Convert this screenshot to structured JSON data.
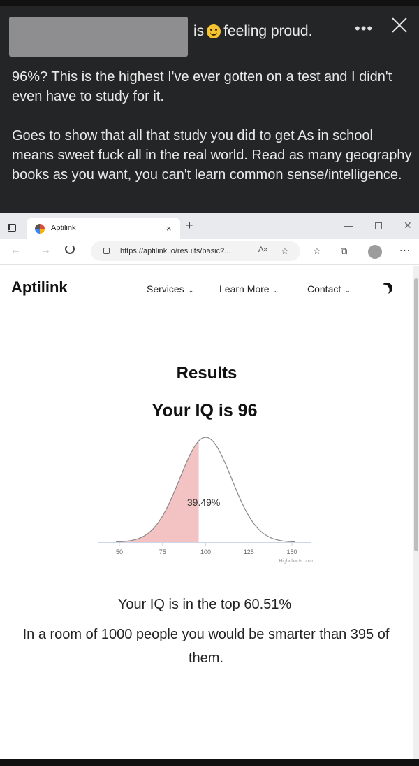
{
  "post": {
    "status_prefix": "is",
    "status_text": "feeling proud.",
    "paragraph1": "96%? This is the highest I've ever gotten on a test and I didn't even have to study for it.",
    "paragraph2": "Goes to show that all that study you did to get As in school means sweet fuck all in the real world. Read as many geography books as you want, you can't learn common sense/intelligence."
  },
  "browser": {
    "tab_title": "Aptilink",
    "tab_close": "×",
    "new_tab": "+",
    "url": "https://aptilink.io/results/basic?...",
    "read_aloud": "A»"
  },
  "site": {
    "logo": "Aptilink",
    "nav": [
      "Services",
      "Learn More",
      "Contact"
    ],
    "results_title": "Results",
    "iq_title": "Your IQ is 96",
    "top_percent_text": "Your IQ is in the top 60.51%",
    "room_text": "In a room of 1000 people you would be smarter than 395 of them."
  },
  "chart_data": {
    "type": "area",
    "distribution": "normal",
    "mean": 100,
    "sd": 15,
    "x_ticks": [
      50,
      75,
      100,
      125,
      150
    ],
    "xlim": [
      50,
      150
    ],
    "shaded_up_to": 96,
    "shaded_label": "39.49%",
    "shaded_color": "#f3c3c3",
    "line_color": "#888888",
    "credit": "Highcharts.com"
  }
}
